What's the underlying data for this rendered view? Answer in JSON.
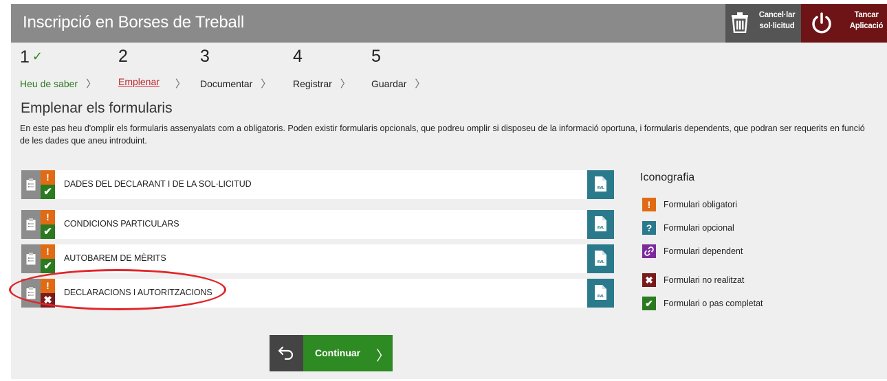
{
  "header": {
    "title": "Inscripció en Borses de Treball",
    "cancel_label_1": "Cancel·lar",
    "cancel_label_2": "sol·licitud",
    "close_label_1": "Tancar",
    "close_label_2": "Aplicació"
  },
  "steps": [
    {
      "number": "1",
      "label": "Heu de saber",
      "state": "done"
    },
    {
      "number": "2",
      "label": "Emplenar",
      "state": "current"
    },
    {
      "number": "3",
      "label": "Documentar",
      "state": "pending"
    },
    {
      "number": "4",
      "label": "Registrar",
      "state": "pending"
    },
    {
      "number": "5",
      "label": "Guardar",
      "state": "pending"
    }
  ],
  "section": {
    "title": "Emplenar els formularis",
    "description": "En este pas heu d'omplir els formularis assenyalats com a obligatoris. Poden existir formularis opcionals, que podreu omplir si disposeu de la informació oportuna, i formularis dependents, que podran ser requerits en funció de les dades que aneu introduint."
  },
  "forms": [
    {
      "name": "DADES DEL DECLARANT I DE LA SOL·LICITUD",
      "required_icon": "!",
      "status": "completed",
      "status_icon": "✔"
    },
    {
      "name": "CONDICIONS PARTICULARS",
      "required_icon": "!",
      "status": "completed",
      "status_icon": "✔"
    },
    {
      "name": "AUTOBAREM DE MÈRITS",
      "required_icon": "!",
      "status": "completed",
      "status_icon": "✔"
    },
    {
      "name": "DECLARACIONS I AUTORITZACIONS",
      "required_icon": "!",
      "status": "not-done",
      "status_icon": "✖"
    }
  ],
  "legend": {
    "title": "Iconografia",
    "items": [
      {
        "label": "Formulari obligatori",
        "icon": "!",
        "color": "#e06b14"
      },
      {
        "label": "Formulari opcional",
        "icon": "?",
        "color": "#2a7a8c"
      },
      {
        "label": "Formulari dependent",
        "icon": "link-icon",
        "color": "#7b2a9c"
      },
      {
        "label": "Formulari no realitzat",
        "icon": "✖",
        "color": "#7a1b1b"
      },
      {
        "label": "Formulari o pas completat",
        "icon": "✔",
        "color": "#2b7a1f"
      }
    ]
  },
  "footer": {
    "continue_label": "Continuar"
  },
  "colors": {
    "header_bg": "#8a8a8a",
    "cancel_bg": "#555555",
    "close_bg": "#6e1416",
    "continue_bg": "#2e8a23",
    "highlight_ellipse": "#e0262b"
  }
}
